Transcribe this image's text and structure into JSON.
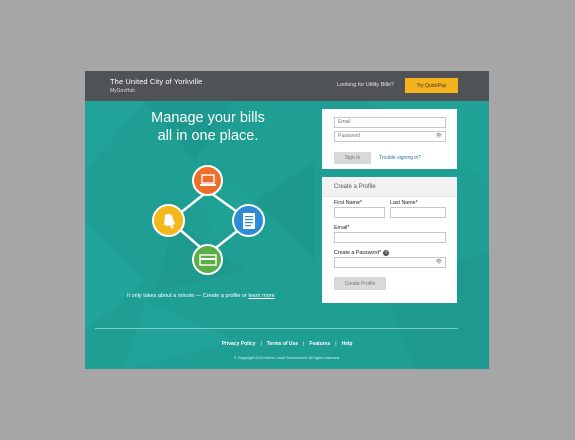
{
  "header": {
    "title": "The United City of Yorkville",
    "subtitle": "MyGovHub",
    "utility_question": "Looking for Utility Bills?",
    "quickpay_label": "Try QuickPay"
  },
  "hero": {
    "headline_line1": "Manage your bills",
    "headline_line2": "all in one place.",
    "cta_text": "It only takes about a minute — Create a profile or ",
    "cta_link": "learn more"
  },
  "icons": {
    "top": "laptop-icon",
    "right": "document-icon",
    "bottom": "credit-card-icon",
    "left": "bell-icon"
  },
  "colors": {
    "background": "#1f9e94",
    "header": "#505356",
    "quickpay": "#f5b21c",
    "icon_orange": "#ee6f2a",
    "icon_blue": "#2f8bd6",
    "icon_green": "#5cad48",
    "icon_yellow": "#f3b81c"
  },
  "login": {
    "email_placeholder": "Email",
    "password_placeholder": "Password",
    "sign_in_label": "Sign In",
    "trouble_link": "Trouble signing in?"
  },
  "profile": {
    "heading": "Create a Profile",
    "first_name_label": "First Name*",
    "last_name_label": "Last Name*",
    "email_label": "Email*",
    "password_label": "Create a Password*",
    "create_button": "Create Profile"
  },
  "footer": {
    "links": [
      "Privacy Policy",
      "Terms of Use",
      "Features",
      "Help"
    ],
    "copyright": "© Copyright 2015 Harris Local Government. All rights reserved."
  }
}
